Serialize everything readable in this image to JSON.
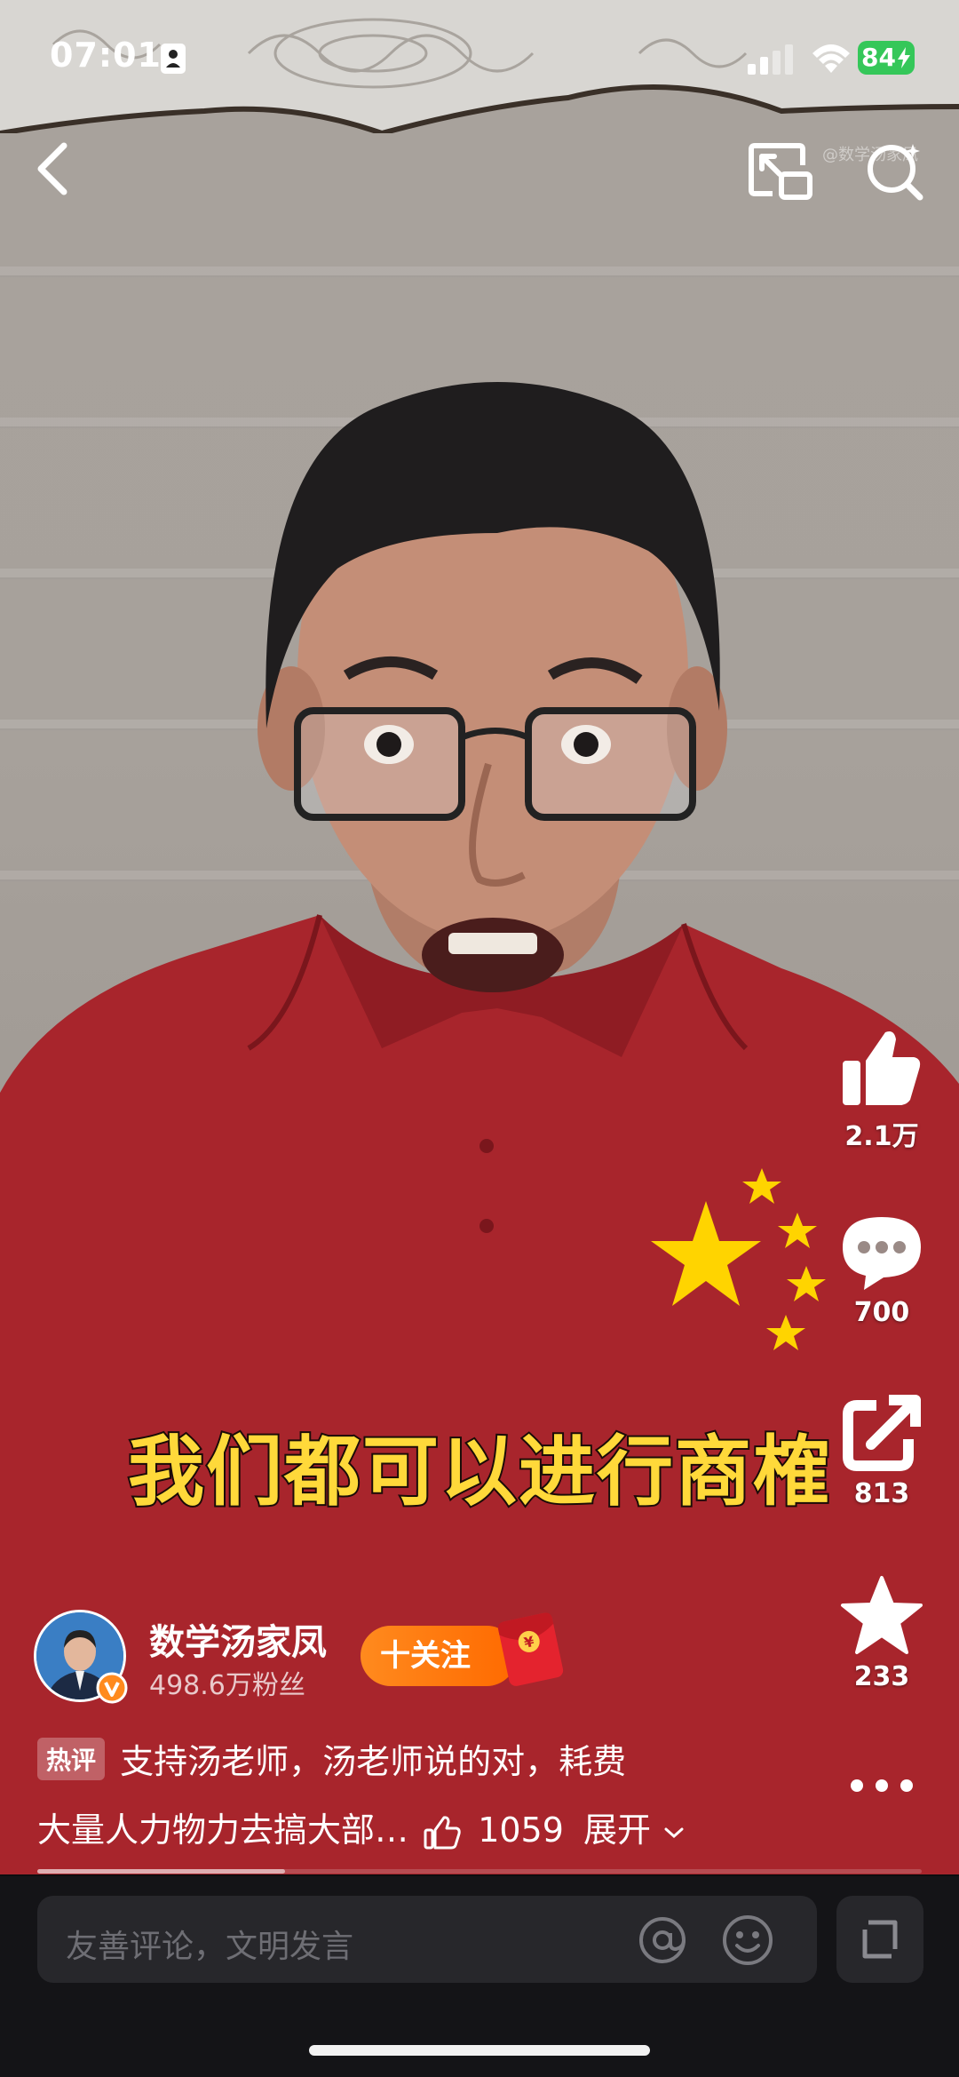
{
  "status_bar": {
    "time": "07:01",
    "battery": "84"
  },
  "watermark": "@数学汤家凤",
  "video": {
    "subtitle": "我们都可以进行商榷"
  },
  "actions": {
    "like_count": "2.1万",
    "comment_count": "700",
    "share_count": "813",
    "favorite_count": "233"
  },
  "author": {
    "name": "数学汤家凤",
    "followers": "498.6万粉丝",
    "follow_label": "十关注"
  },
  "hot_comment": {
    "badge": "热评",
    "line1": "支持汤老师，汤老师说的对，耗费",
    "line2": "大量人力物力去搞大部…",
    "likes": "1059",
    "expand_label": "展开"
  },
  "progress": {
    "fraction": 0.28
  },
  "comment_input": {
    "placeholder": "友善评论，文明发言"
  },
  "colors": {
    "follow_orange": "#ff7a10",
    "subtitle_yellow": "#ffd93a",
    "battery_green": "#35c759",
    "shirt_red": "#a8252c"
  },
  "icons": [
    "back-icon",
    "cast-icon",
    "search-icon",
    "thumbs-up-icon",
    "comment-icon",
    "share-icon",
    "star-icon",
    "more-icon",
    "verified-icon",
    "redpacket-icon",
    "at-icon",
    "emoji-icon",
    "fullscreen-icon"
  ]
}
